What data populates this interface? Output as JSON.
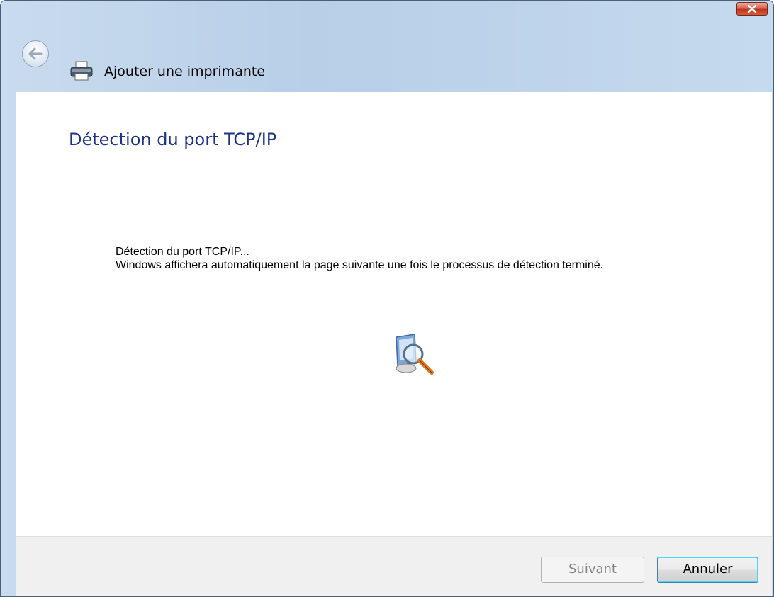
{
  "window": {
    "title": "Ajouter une imprimante"
  },
  "titlebar": {
    "close_icon": "close-icon"
  },
  "nav": {
    "back_icon": "back-arrow-icon",
    "app_icon": "printer-icon"
  },
  "content": {
    "heading": "Détection du port TCP/IP",
    "status_line": "Détection du port TCP/IP...",
    "info_line": "Windows affichera automatiquement la page suivante une fois le processus de détection terminé.",
    "progress_icon": "search-computer-icon"
  },
  "footer": {
    "next_label": "Suivant",
    "cancel_label": "Annuler"
  },
  "colors": {
    "heading": "#1e3287",
    "frame": "#bcd2ea",
    "close_button": "#c2351c"
  }
}
